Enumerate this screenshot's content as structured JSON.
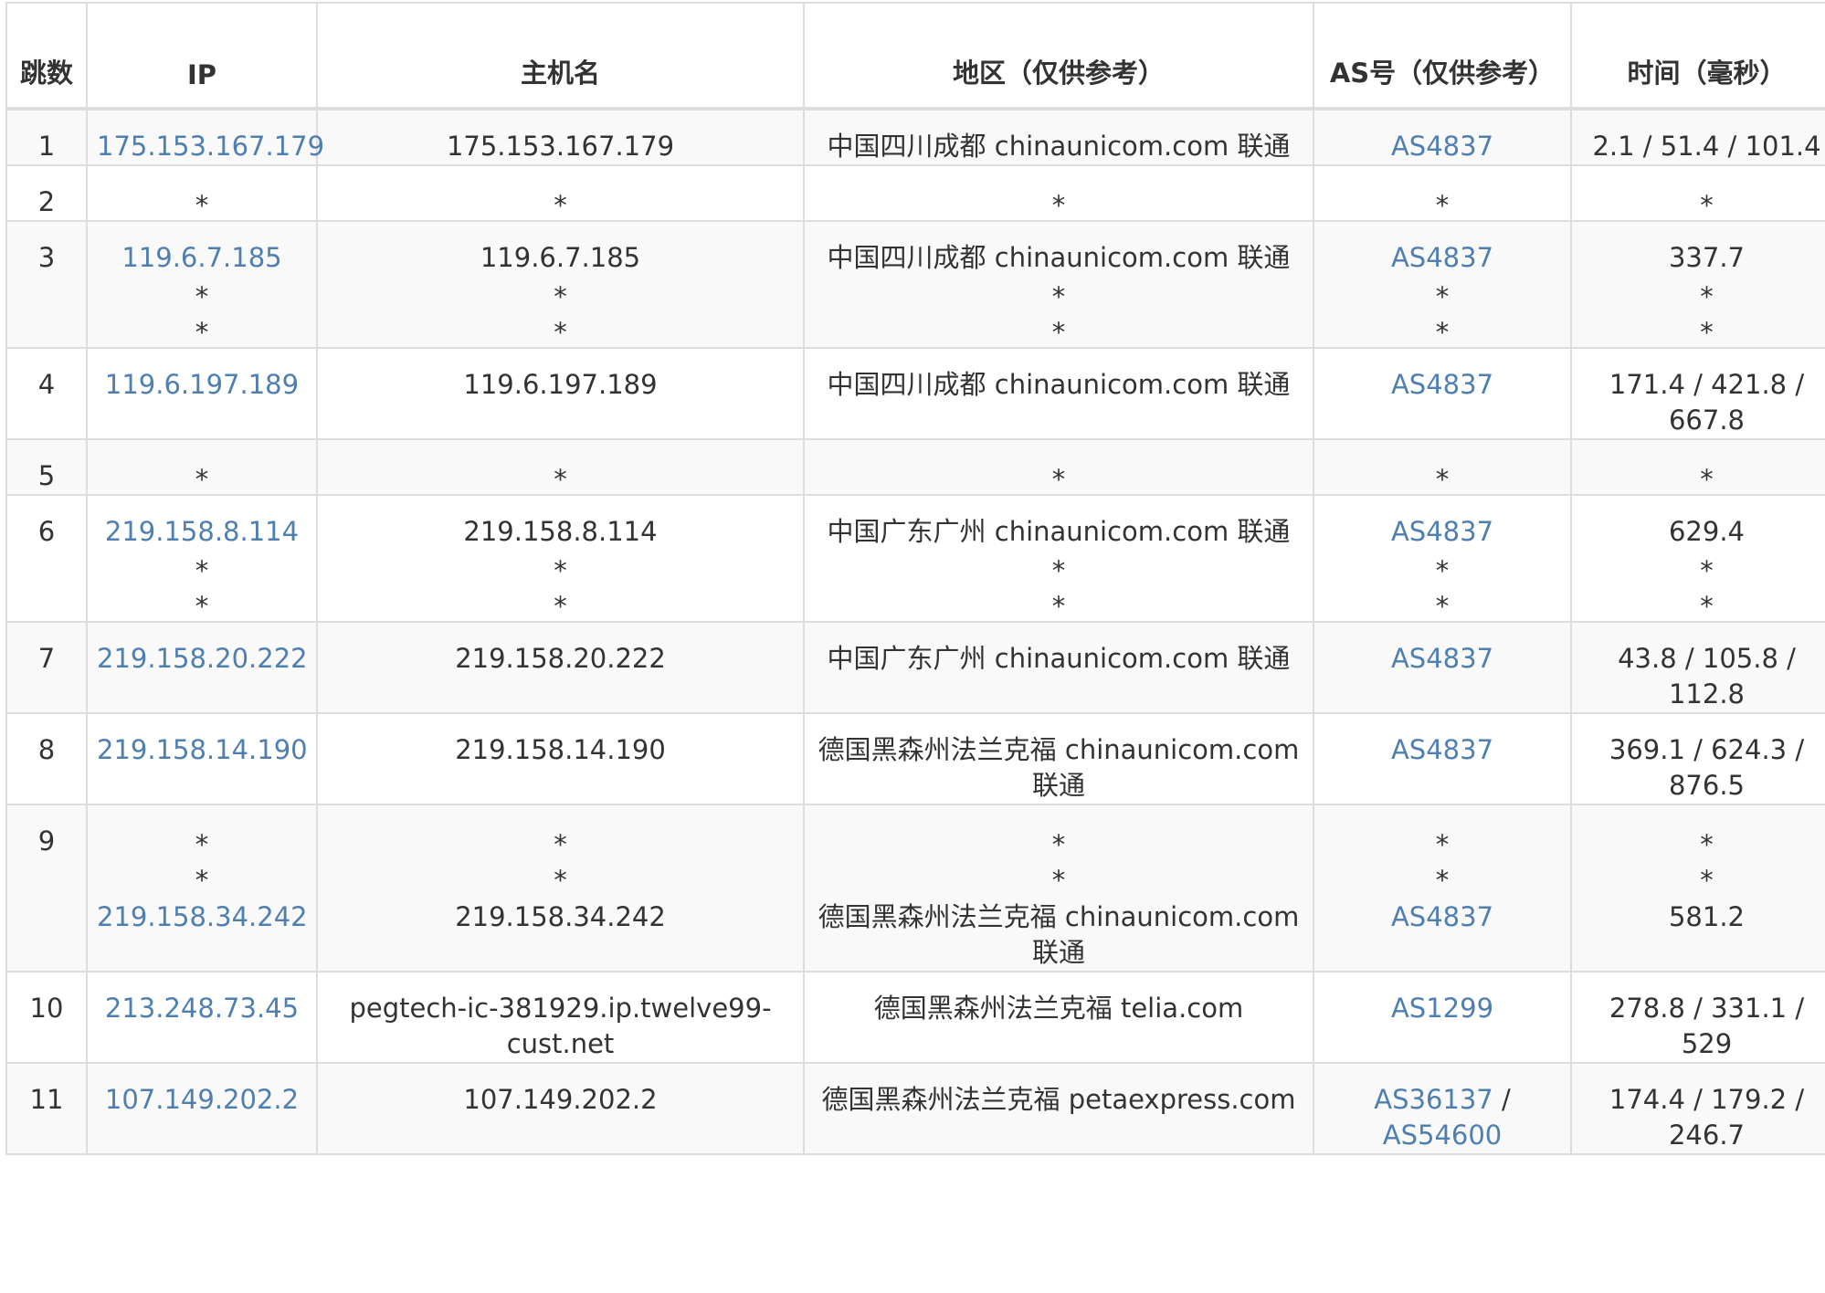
{
  "headers": {
    "hop": "跳数",
    "ip": "IP",
    "hostname": "主机名",
    "region": "地区（仅供参考）",
    "as": "AS号（仅供参考）",
    "time": "时间（毫秒）"
  },
  "rows": [
    {
      "hop": "1",
      "h": 58,
      "ip": [
        "175.153.167.179"
      ],
      "host": [
        "175.153.167.179"
      ],
      "region": [
        "中国四川成都 chinaunicom.com 联通"
      ],
      "as": [
        [
          "AS4837"
        ]
      ],
      "time": [
        "2.1 / 51.4 / 101.4"
      ]
    },
    {
      "hop": "2",
      "h": 58,
      "ip": [
        "*"
      ],
      "host": [
        "*"
      ],
      "region": [
        "*"
      ],
      "as": [
        [
          "*"
        ]
      ],
      "time": [
        "*"
      ]
    },
    {
      "hop": "3",
      "h": 121,
      "ip": [
        "119.6.7.185",
        "*",
        "*"
      ],
      "host": [
        "119.6.7.185",
        "*",
        "*"
      ],
      "region": [
        "中国四川成都 chinaunicom.com 联通",
        "*",
        "*"
      ],
      "as": [
        [
          "AS4837"
        ],
        [
          "*"
        ],
        [
          "*"
        ]
      ],
      "time": [
        "337.7",
        "*",
        "*"
      ]
    },
    {
      "hop": "4",
      "h": 90,
      "ip": [
        "119.6.197.189"
      ],
      "host": [
        "119.6.197.189"
      ],
      "region": [
        "中国四川成都 chinaunicom.com 联通"
      ],
      "as": [
        [
          "AS4837"
        ]
      ],
      "time": [
        "171.4 / 421.8 / 667.8"
      ]
    },
    {
      "hop": "5",
      "h": 58,
      "ip": [
        "*"
      ],
      "host": [
        "*"
      ],
      "region": [
        "*"
      ],
      "as": [
        [
          "*"
        ]
      ],
      "time": [
        "*"
      ]
    },
    {
      "hop": "6",
      "h": 121,
      "ip": [
        "219.158.8.114",
        "*",
        "*"
      ],
      "host": [
        "219.158.8.114",
        "*",
        "*"
      ],
      "region": [
        "中国广东广州 chinaunicom.com 联通",
        "*",
        "*"
      ],
      "as": [
        [
          "AS4837"
        ],
        [
          "*"
        ],
        [
          "*"
        ]
      ],
      "time": [
        "629.4",
        "*",
        "*"
      ]
    },
    {
      "hop": "7",
      "h": 90,
      "ip": [
        "219.158.20.222"
      ],
      "host": [
        "219.158.20.222"
      ],
      "region": [
        "中国广东广州 chinaunicom.com 联通"
      ],
      "as": [
        [
          "AS4837"
        ]
      ],
      "time": [
        "43.8 / 105.8 / 112.8"
      ]
    },
    {
      "hop": "8",
      "h": 90,
      "ip": [
        "219.158.14.190"
      ],
      "host": [
        "219.158.14.190"
      ],
      "region": [
        "德国黑森州法兰克福 chinaunicom.com 联通"
      ],
      "as": [
        [
          "AS4837"
        ]
      ],
      "time": [
        "369.1 / 624.3 / 876.5"
      ]
    },
    {
      "hop": "9",
      "h": 152,
      "ip": [
        "*",
        "*",
        "219.158.34.242"
      ],
      "host": [
        "*",
        "*",
        "219.158.34.242"
      ],
      "region": [
        "*",
        "*",
        "德国黑森州法兰克福 chinaunicom.com 联通"
      ],
      "as": [
        [
          "*"
        ],
        [
          "*"
        ],
        [
          "AS4837"
        ]
      ],
      "time": [
        "*",
        "*",
        "581.2"
      ]
    },
    {
      "hop": "10",
      "h": 90,
      "ip": [
        "213.248.73.45"
      ],
      "host": [
        "pegtech-ic-381929.ip.twelve99-cust.net"
      ],
      "region": [
        "德国黑森州法兰克福 telia.com"
      ],
      "as": [
        [
          "AS1299"
        ]
      ],
      "time": [
        "278.8 / 331.1 / 529"
      ]
    },
    {
      "hop": "11",
      "h": 90,
      "ip": [
        "107.149.202.2"
      ],
      "host": [
        "107.149.202.2"
      ],
      "region": [
        "德国黑森州法兰克福 petaexpress.com"
      ],
      "as": [
        [
          "AS36137",
          "AS54600"
        ]
      ],
      "time": [
        "174.4 / 179.2 / 246.7"
      ]
    }
  ]
}
